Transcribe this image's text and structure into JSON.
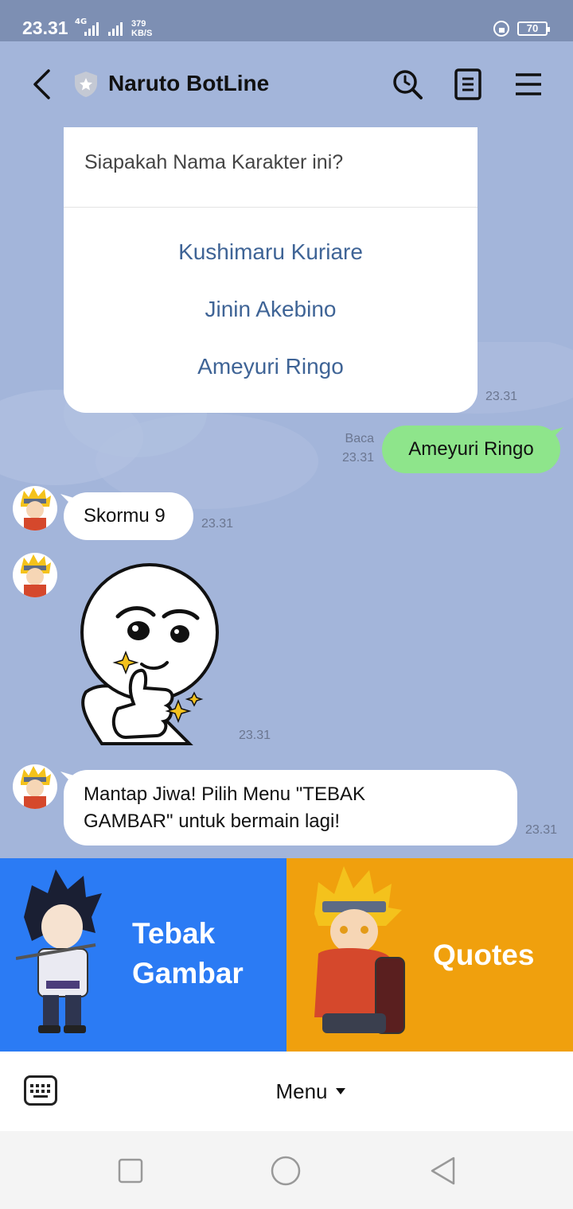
{
  "status_bar": {
    "time": "23.31",
    "network": "4G",
    "speed_value": "379",
    "speed_unit": "KB/S",
    "battery": "70"
  },
  "header": {
    "title": "Naruto BotLine"
  },
  "chat": {
    "quiz": {
      "question": "Siapakah Nama Karakter ini?",
      "options": [
        "Kushimaru Kuriare",
        "Jinin Akebino",
        "Ameyuri Ringo"
      ],
      "time": "23.31"
    },
    "user_reply": {
      "text": "Ameyuri Ringo",
      "read_label": "Baca",
      "time": "23.31"
    },
    "score": {
      "text": "Skormu 9",
      "time": "23.31"
    },
    "sticker": {
      "time": "23.31"
    },
    "final": {
      "text_line1": "Mantap Jiwa! Pilih Menu \"TEBAK",
      "text_line2": "GAMBAR\" untuk bermain lagi!",
      "time": "23.31"
    }
  },
  "rich_menu": {
    "left_line1": "Tebak",
    "left_line2": "Gambar",
    "right": "Quotes"
  },
  "bottom_bar": {
    "menu_label": "Menu"
  },
  "colors": {
    "background": "#a3b5da",
    "tebak_bg": "#2b7bf4",
    "quotes_bg": "#f0a00d",
    "outgoing_bubble": "#8ee58b",
    "option_text": "#3f6496"
  }
}
